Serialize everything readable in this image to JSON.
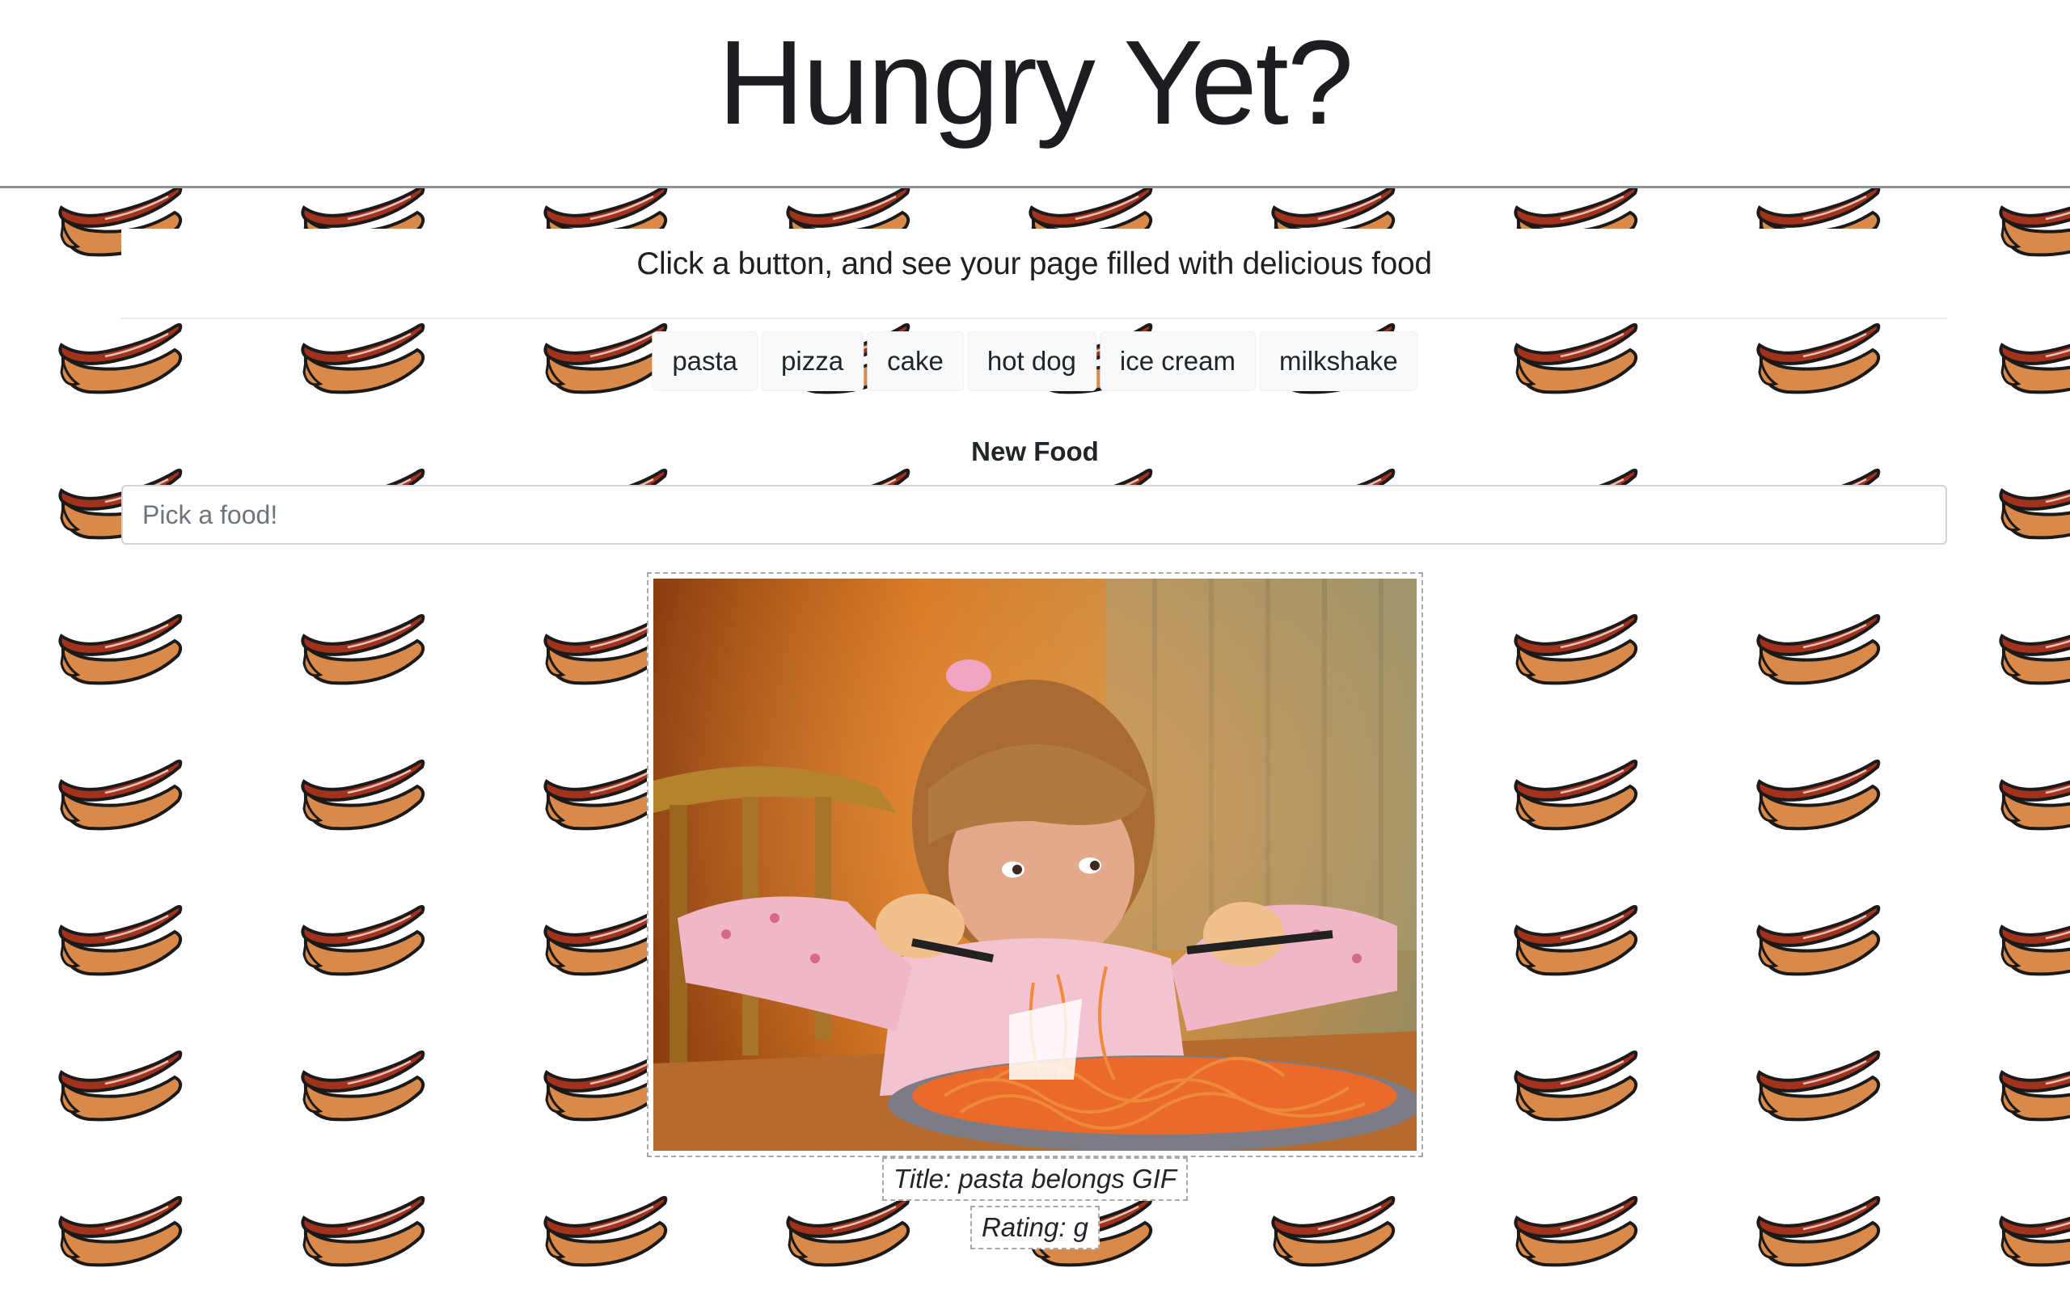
{
  "page": {
    "title": "Hungry Yet?",
    "lead": "Click a button, and see your page filled with delicious food"
  },
  "buttons": [
    "pasta",
    "pizza",
    "cake",
    "hot dog",
    "ice cream",
    "milkshake"
  ],
  "form": {
    "label": "New Food",
    "placeholder": "Pick a food!"
  },
  "gif": {
    "title_text": "Title: pasta belongs GIF",
    "rating_text": "Rating: g"
  },
  "background_tile_icon": "hot-dog-icon",
  "colors": {
    "bun": "#d98a4a",
    "sausage": "#a3321c",
    "outline": "#1a1a1a",
    "button_bg": "#f8f9fa",
    "header_rule": "#8f8f8f"
  }
}
